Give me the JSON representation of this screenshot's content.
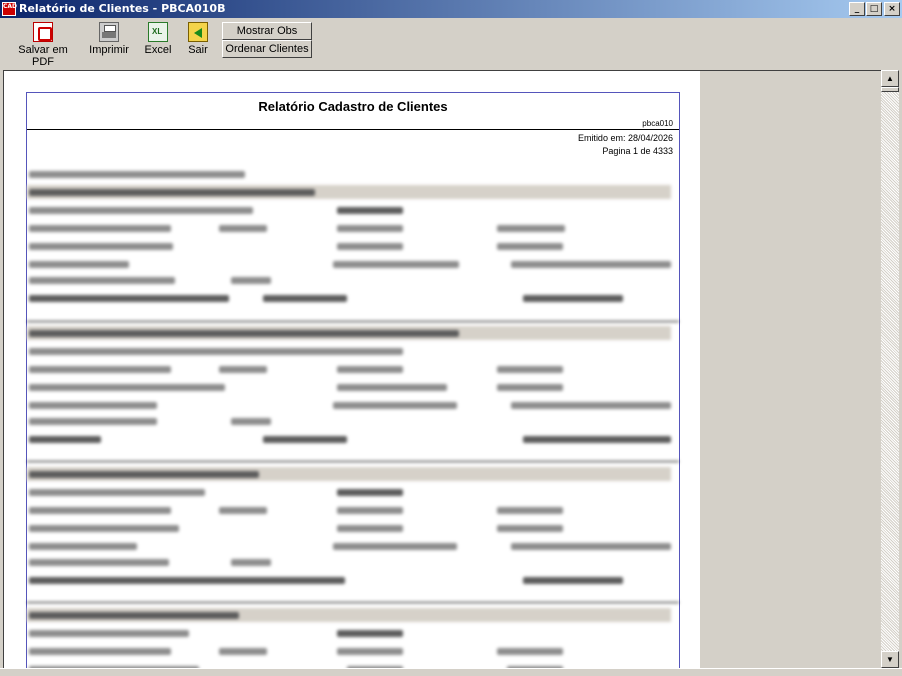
{
  "window": {
    "title": "Relatório de Clientes - PBCA010B",
    "app_icon_text": "CAD",
    "controls": {
      "minimize": "_",
      "maximize": "□",
      "close": "×"
    }
  },
  "toolbar": {
    "pdf_label": "Salvar em PDF",
    "print_label": "Imprimir",
    "excel_label": "Excel",
    "exit_label": "Sair",
    "show_obs_label": "Mostrar Obs",
    "sort_label": "Ordenar Clientes"
  },
  "report": {
    "title": "Relatório Cadastro de Clientes",
    "code": "pbca010",
    "issued": "Emitido em: 28/04/2026",
    "page": "Pagina 1 de 4333"
  },
  "scrollbar": {
    "up_glyph": "▲",
    "down_glyph": "▼"
  }
}
